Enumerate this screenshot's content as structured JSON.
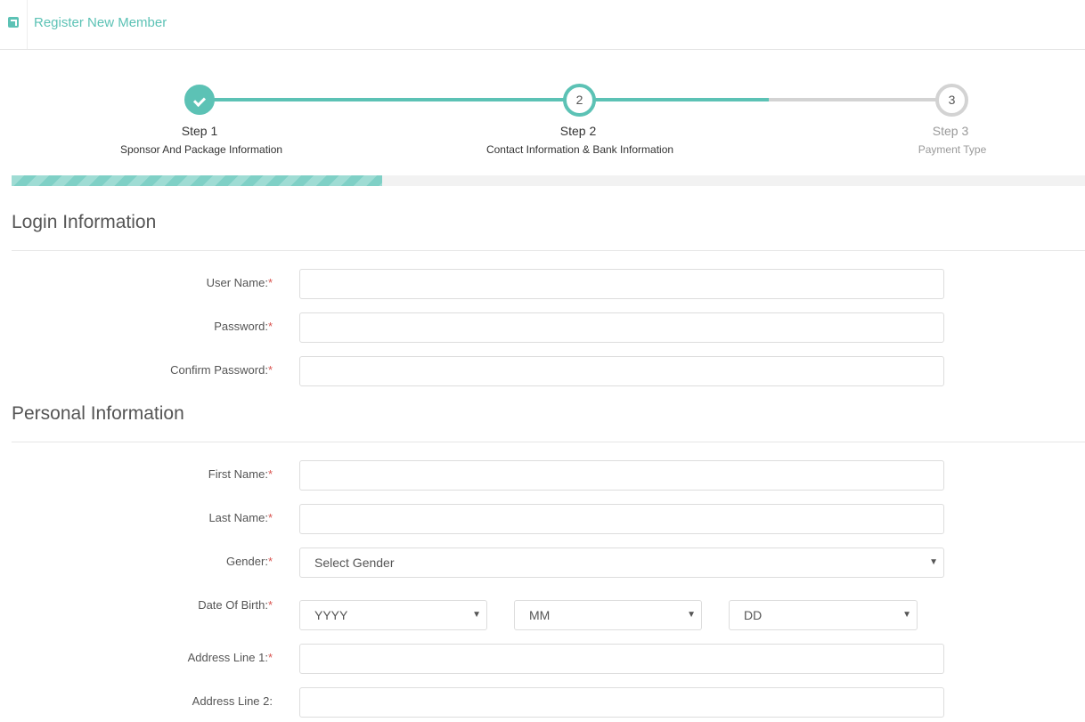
{
  "header": {
    "title": "Register New Member",
    "icon": "external-link-icon"
  },
  "wizard": {
    "progress_percent": 34.5,
    "steps": [
      {
        "number": "",
        "name": "Step 1",
        "desc": "Sponsor And Package Information",
        "state": "complete"
      },
      {
        "number": "2",
        "name": "Step 2",
        "desc": "Contact Information & Bank Information",
        "state": "active"
      },
      {
        "number": "3",
        "name": "Step 3",
        "desc": "Payment Type",
        "state": "pending"
      }
    ]
  },
  "login": {
    "title": "Login Information",
    "username_label": "User Name:",
    "password_label": "Password:",
    "confirm_label": "Confirm Password:"
  },
  "personal": {
    "title": "Personal Information",
    "first_label": "First Name:",
    "last_label": "Last Name:",
    "gender_label": "Gender:",
    "gender_value": "Select Gender",
    "dob_label": "Date Of Birth:",
    "dob_year": "YYYY",
    "dob_month": "MM",
    "dob_day": "DD",
    "addr1_label": "Address Line 1:",
    "addr2_label": "Address Line 2:"
  },
  "required_mark": "*",
  "colors": {
    "accent": "#5cc2b5",
    "required": "#d9534f",
    "pending": "#d3d3d3"
  }
}
